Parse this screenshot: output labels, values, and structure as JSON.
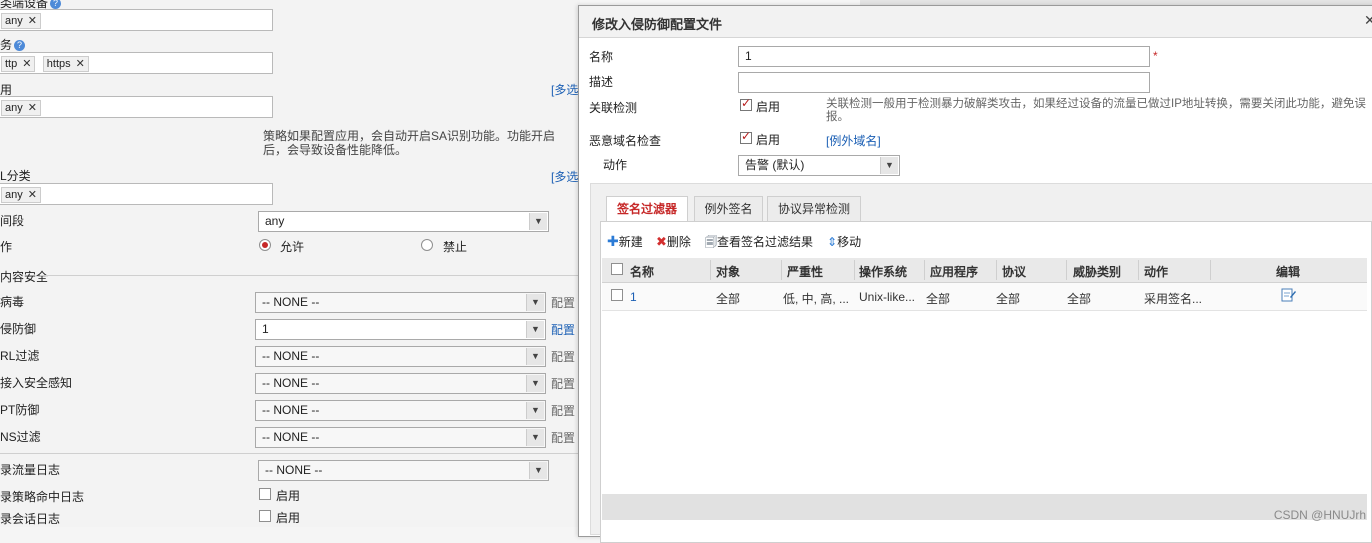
{
  "background_form": {
    "fields": [
      {
        "label": "类端设备",
        "help": "?",
        "tags": [
          "any"
        ]
      },
      {
        "label": "务",
        "help": "?",
        "tags": [
          "ttp",
          "https"
        ]
      },
      {
        "label": "用",
        "tags": [
          "any"
        ],
        "link": "[多选"
      },
      {
        "label": "L分类",
        "tags": [
          "any"
        ],
        "link": "[多选"
      }
    ],
    "app_note": "策略如果配置应用，会自动开启SA识别功能。功能开启后，会导致设备性能降低。",
    "time_label": "间段",
    "time_value": "any",
    "action_label": "作",
    "action_options": [
      {
        "label": "允许",
        "selected": true
      },
      {
        "label": "禁止",
        "selected": false
      }
    ],
    "content_security_title": "内容安全",
    "security_rows": [
      {
        "label": "病毒",
        "value": "-- NONE --",
        "config": "配置",
        "active": false
      },
      {
        "label": "侵防御",
        "value": "1",
        "config": "配置",
        "active": true
      },
      {
        "label": "RL过滤",
        "value": "-- NONE --",
        "config": "配置",
        "active": false
      },
      {
        "label": "接入安全感知",
        "value": "-- NONE --",
        "config": "配置",
        "active": false
      },
      {
        "label": "PT防御",
        "value": "-- NONE --",
        "config": "配置",
        "active": false
      },
      {
        "label": "NS过滤",
        "value": "-- NONE --",
        "config": "配置",
        "active": false
      }
    ],
    "log_rows": [
      {
        "label": "录流量日志",
        "type": "select",
        "value": "-- NONE --"
      },
      {
        "label": "录策略命中日志",
        "type": "checkbox",
        "value": "启用"
      },
      {
        "label": "录会话日志",
        "type": "checkbox",
        "value": "启用"
      }
    ]
  },
  "dialog": {
    "title": "修改入侵防御配置文件",
    "name_label": "名称",
    "name_value": "1",
    "required_mark": "*",
    "desc_label": "描述",
    "desc_value": "",
    "correlation_label": "关联检测",
    "correlation_check": "启用",
    "correlation_hint": "关联检测一般用于检测暴力破解类攻击，如果经过设备的流量已做过IP地址转换，需要关闭此功能，避免误报。",
    "malicious_label": "恶意域名检查",
    "malicious_check": "启用",
    "exception_domain_link": "[例外域名]",
    "action_label": "动作",
    "action_value": "告警 (默认)",
    "tabs": [
      {
        "label": "签名过滤器",
        "active": true
      },
      {
        "label": "例外签名",
        "active": false
      },
      {
        "label": "协议异常检测",
        "active": false
      }
    ],
    "toolbar": {
      "new": "新建",
      "delete": "删除",
      "view": "查看签名过滤结果",
      "move": "移动"
    },
    "grid": {
      "columns": [
        "名称",
        "对象",
        "严重性",
        "操作系统",
        "应用程序",
        "协议",
        "威胁类别",
        "动作",
        "编辑"
      ],
      "rows": [
        {
          "name": "1",
          "object": "全部",
          "severity": "低, 中, 高, ...",
          "os": "Unix-like...",
          "app": "全部",
          "protocol": "全部",
          "threat": "全部",
          "action": "采用签名..."
        }
      ]
    }
  },
  "watermark": "CSDN @HNUJrh"
}
